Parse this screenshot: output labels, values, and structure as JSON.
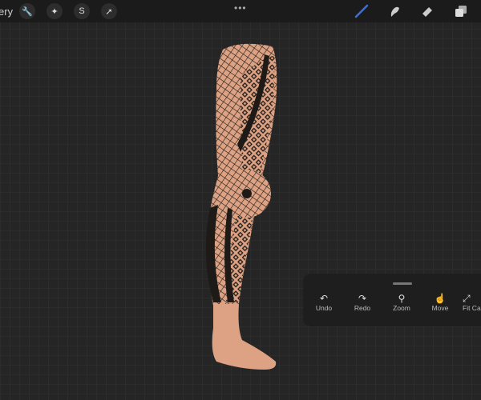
{
  "topbar": {
    "gallery_label": "ery",
    "more_label": "•••",
    "left_tools": [
      {
        "icon": "wrench-icon",
        "glyph": "🔧"
      },
      {
        "icon": "magic-wand-icon",
        "glyph": "✦"
      },
      {
        "icon": "selection-icon",
        "glyph": "S"
      },
      {
        "icon": "transform-arrow-icon",
        "glyph": "➚"
      }
    ],
    "active_color": "#3b6fe0"
  },
  "quick_menu": {
    "items": [
      {
        "label": "Undo",
        "glyph": "↶"
      },
      {
        "label": "Redo",
        "glyph": "↷"
      },
      {
        "label": "Zoom",
        "glyph": "⚲"
      },
      {
        "label": "Move",
        "glyph": "☝"
      },
      {
        "label": "Fit Ca",
        "glyph": "⤢"
      }
    ]
  },
  "artwork": {
    "skin_color": "#dda283",
    "pattern_color": "#1d1a18"
  }
}
